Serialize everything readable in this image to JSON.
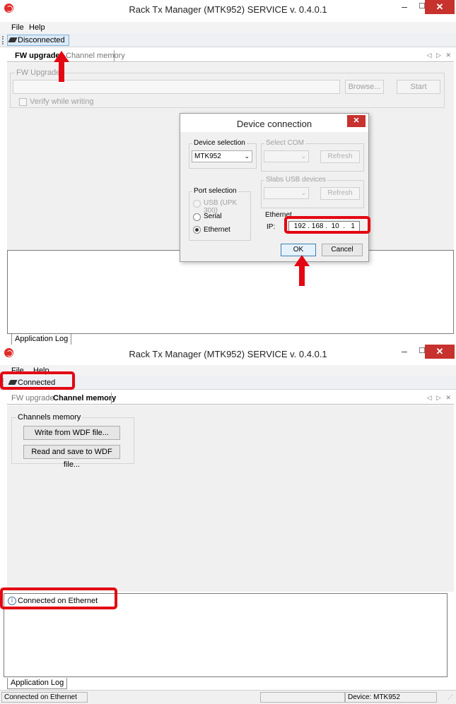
{
  "top_window": {
    "title": "Rack Tx Manager (MTK952) SERVICE v. 0.4.0.1",
    "menu": [
      "File",
      "Help"
    ],
    "toolbar": {
      "connection_label": "Disconnected"
    },
    "tabs": [
      "FW upgrade",
      "Channel memory"
    ],
    "fw_group": {
      "label": "FW Upgrade",
      "browse_label": "Browse...",
      "start_label": "Start",
      "verify_label": "Verify while writing"
    },
    "log_tab": "Application Log"
  },
  "dialog": {
    "title": "Device connection",
    "close": "✕",
    "device_selection": {
      "label": "Device selection",
      "value": "MTK952"
    },
    "select_com": {
      "label": "Select COM",
      "refresh": "Refresh"
    },
    "slabs_usb": {
      "label": "Slabs USB devices",
      "refresh": "Refresh"
    },
    "port_selection": {
      "label": "Port selection",
      "options": [
        "USB (UPK 300)",
        "Serial",
        "Ethernet"
      ],
      "selected": "Ethernet"
    },
    "ethernet": {
      "label": "Ethernet",
      "ip_label": "IP:",
      "ip_value": " 192 . 168 .  10  .   1"
    },
    "ok_label": "OK",
    "cancel_label": "Cancel"
  },
  "bottom_window": {
    "title": "Rack Tx Manager (MTK952) SERVICE v. 0.4.0.1",
    "menu": [
      "File",
      "Help"
    ],
    "toolbar": {
      "connection_label": "Connected"
    },
    "tabs": [
      "FW upgrade",
      "Channel memory"
    ],
    "channels_group": {
      "label": "Channels memory",
      "write_button": "Write from WDF file...",
      "read_button": "Read and save to WDF file..."
    },
    "log_entry": "Connected on Ethernet",
    "log_tab": "Application Log",
    "status": {
      "left": "Connected on Ethernet",
      "device": "Device: MTK952"
    }
  },
  "colors": {
    "highlight": "#e30613",
    "close_button": "#c7312e",
    "panel": "#f0f0f0"
  },
  "icons": [
    "app-logo-icon",
    "minimize-icon",
    "maximize-icon",
    "close-icon",
    "plug-icon",
    "dropdown-arrow-icon",
    "info-icon",
    "arrow-up-icon"
  ]
}
